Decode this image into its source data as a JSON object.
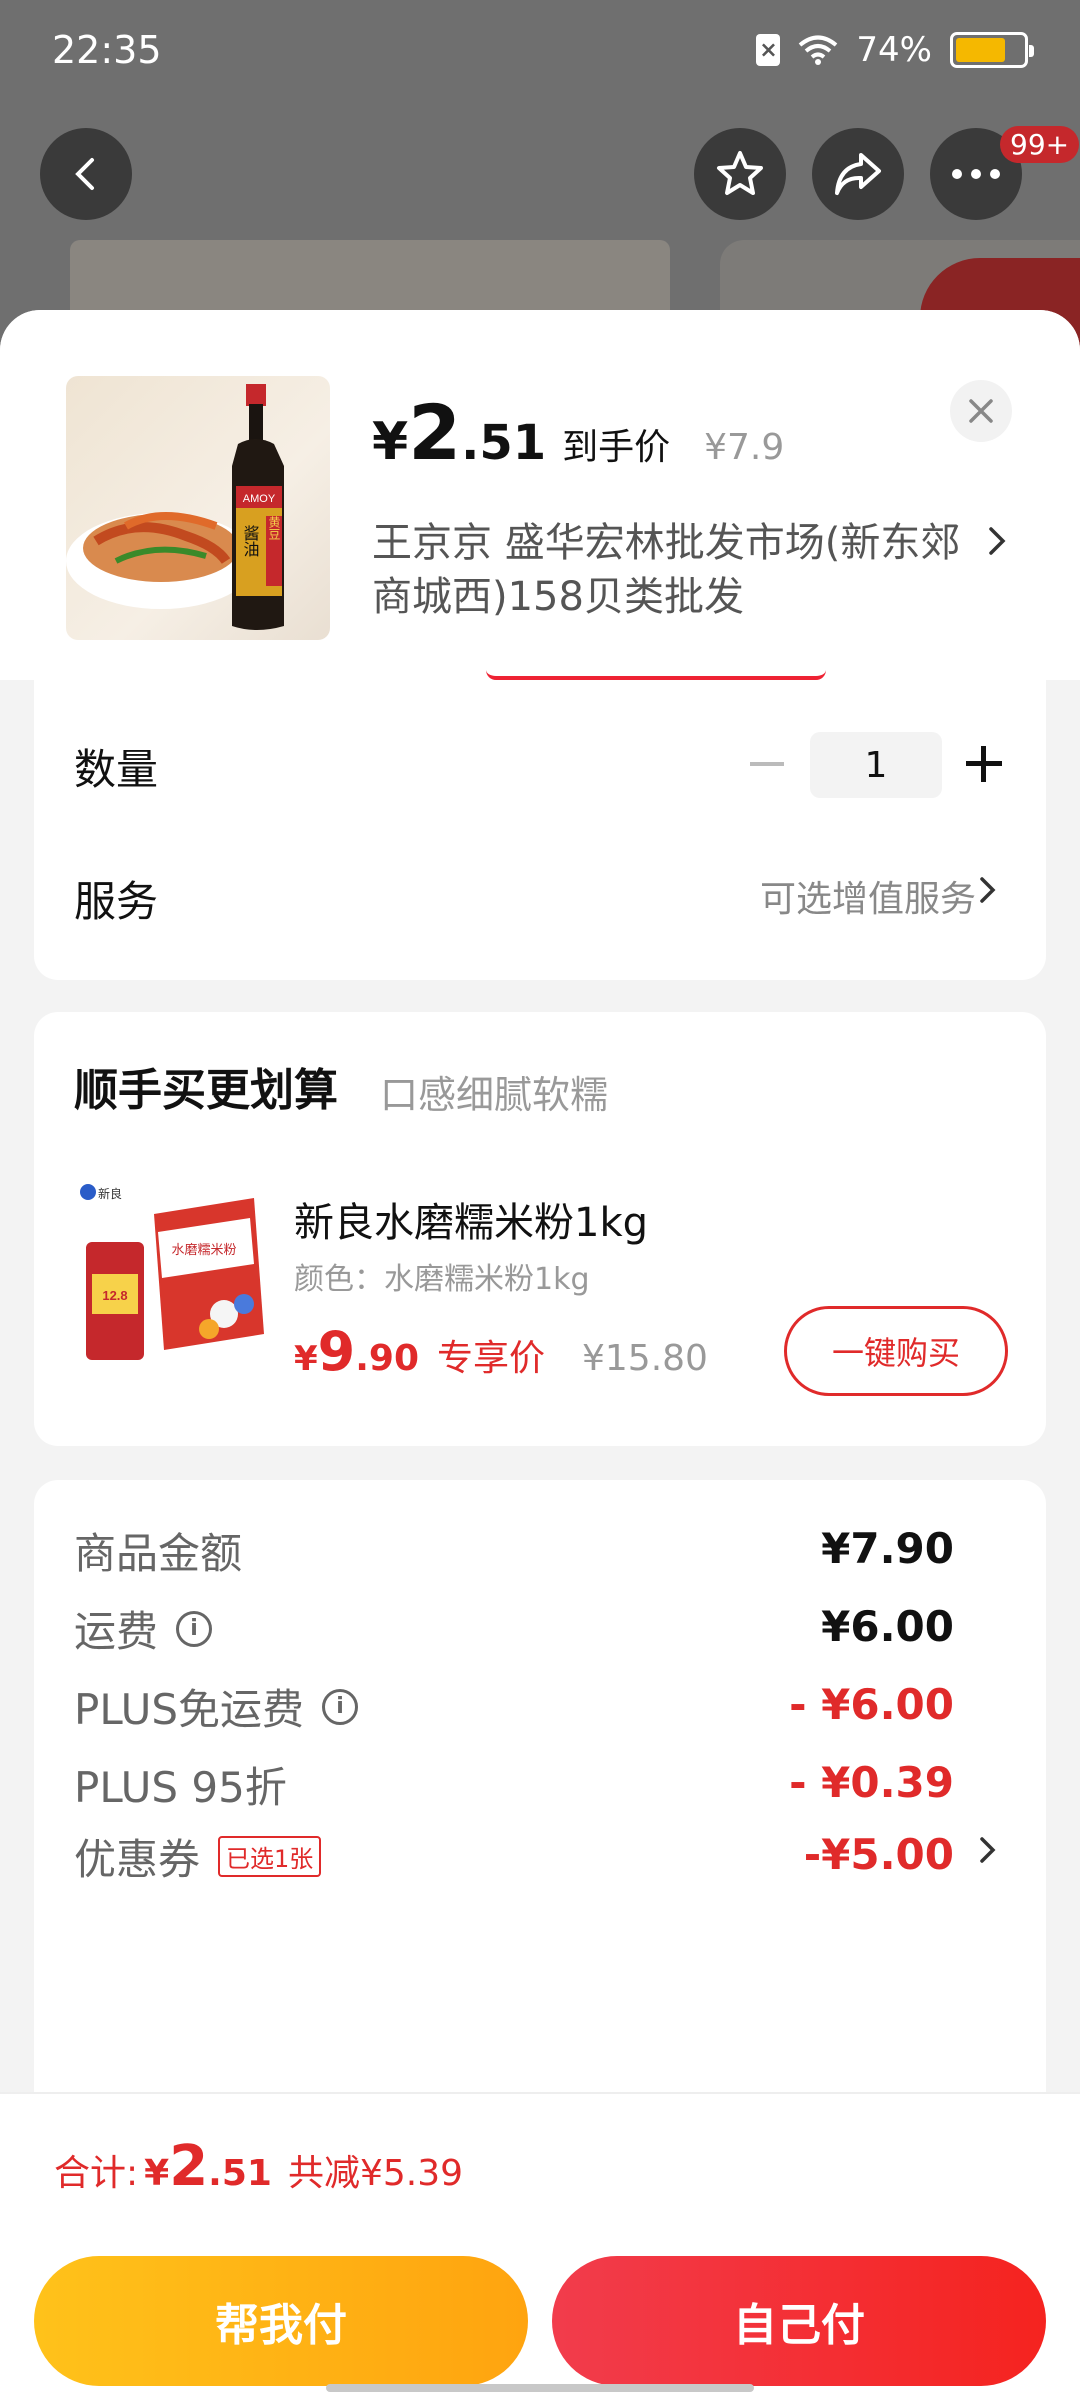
{
  "status_bar": {
    "time": "22:35",
    "battery": "74%",
    "battery_level": 0.74
  },
  "nav": {
    "badge": "99+"
  },
  "product": {
    "price_yen": "¥",
    "price_int": "2",
    "price_dec": ".51",
    "price_label": "到手价",
    "original_price": "¥7.9",
    "shop_name": "王京京  盛华宏林批发市场(新东郊商城西)158贝类批发",
    "thumb_label_top": "酱油",
    "thumb_label_side": "黄豆",
    "thumb_brand": "AMOY"
  },
  "quantity": {
    "label": "数量",
    "value": "1"
  },
  "service": {
    "label": "服务",
    "value": "可选增值服务"
  },
  "bundle": {
    "title": "顺手买更划算",
    "subtitle": "口感细腻软糯",
    "item_name": "新良水磨糯米粉1kg",
    "item_color": "颜色：水磨糯米粉1kg",
    "price_yen": "¥",
    "price_int": "9",
    "price_dec": ".90",
    "price_label": "专享价",
    "original_price": "¥15.80",
    "buy_label": "一键购买",
    "pack_text": "水磨糯米粉",
    "pack_brand": "新良",
    "tag_text": "12.8"
  },
  "summary": {
    "rows": [
      {
        "label": "商品金额",
        "value": "¥7.90"
      },
      {
        "label": "运费",
        "value": "¥6.00"
      },
      {
        "label": "PLUS免运费",
        "value": "- ¥6.00"
      },
      {
        "label": "PLUS 95折",
        "value": "- ¥0.39"
      },
      {
        "label": "优惠券",
        "tag": "已选1张",
        "value": "-¥5.00"
      }
    ]
  },
  "bottom": {
    "total_label": "合计:",
    "total_yen": "¥",
    "total_int": "2",
    "total_dec": ".51",
    "saved": "共减¥5.39",
    "help_pay": "帮我付",
    "self_pay": "自己付"
  },
  "colors": {
    "accent_red": "#e02a2a",
    "accent_yellow": "#ffb414"
  }
}
